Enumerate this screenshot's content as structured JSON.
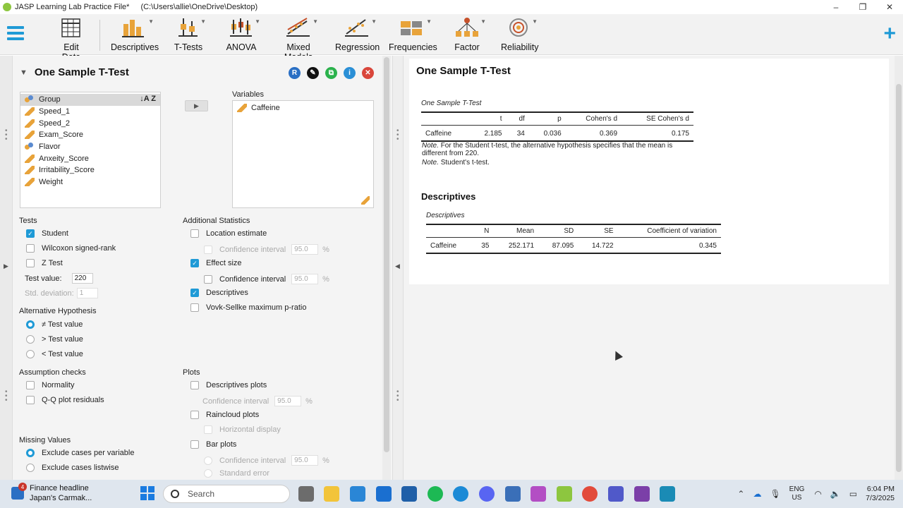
{
  "window": {
    "title": "JASP Learning Lab Practice File*",
    "path": "(C:\\Users\\allie\\OneDrive\\Desktop)",
    "minimize": "–",
    "maximize": "❐",
    "close": "✕"
  },
  "ribbon": {
    "edit_data": "Edit Data",
    "modules": [
      "Descriptives",
      "T-Tests",
      "ANOVA",
      "Mixed Models",
      "Regression",
      "Frequencies",
      "Factor",
      "Reliability"
    ],
    "plus": "+"
  },
  "analysis": {
    "title": "One Sample T-Test",
    "btn_r": "R",
    "btn_edit": "✎",
    "btn_copy": "⧉",
    "btn_info": "i",
    "btn_close": "✕",
    "available_vars": [
      {
        "name": "Group",
        "type": "nominal"
      },
      {
        "name": "Speed_1",
        "type": "scale"
      },
      {
        "name": "Speed_2",
        "type": "scale"
      },
      {
        "name": "Exam_Score",
        "type": "scale"
      },
      {
        "name": "Flavor",
        "type": "nominal"
      },
      {
        "name": "Anxeity_Score",
        "type": "scale"
      },
      {
        "name": "Irritability_Score",
        "type": "scale"
      },
      {
        "name": "Weight",
        "type": "scale"
      }
    ],
    "sort_icon": "↓A Z",
    "variables_label": "Variables",
    "selected_vars": [
      "Caffeine"
    ],
    "tests": {
      "label": "Tests",
      "student": "Student",
      "wilcoxon": "Wilcoxon signed-rank",
      "z_test": "Z Test",
      "test_value_label": "Test value:",
      "test_value": "220",
      "std_dev_label": "Std. deviation:",
      "std_dev": "1"
    },
    "alt_hypothesis": {
      "label": "Alternative Hypothesis",
      "neq": "≠ Test value",
      "gt": "> Test value",
      "lt": "< Test value"
    },
    "assumption": {
      "label": "Assumption checks",
      "normality": "Normality",
      "qq": "Q-Q plot residuals"
    },
    "missing": {
      "label": "Missing Values",
      "per_variable": "Exclude cases per variable",
      "listwise": "Exclude cases listwise"
    },
    "additional": {
      "label": "Additional Statistics",
      "location": "Location estimate",
      "ci": "Confidence interval",
      "ci_value": "95.0",
      "pct": "%",
      "effect_size": "Effect size",
      "ci2": "Confidence interval",
      "ci2_value": "95.0",
      "descriptives": "Descriptives",
      "vovk": "Vovk-Sellke maximum p-ratio"
    },
    "plots": {
      "label": "Plots",
      "desc_plots": "Descriptives plots",
      "ci": "Confidence interval",
      "ci_value": "95.0",
      "raincloud": "Raincloud plots",
      "horizontal": "Horizontal display",
      "bar": "Bar plots",
      "bar_ci": "Confidence interval",
      "bar_ci_value": "95.0",
      "std_error": "Standard error"
    }
  },
  "results": {
    "title": "One Sample T-Test",
    "table1": {
      "caption": "One Sample T-Test",
      "headers": [
        "",
        "t",
        "df",
        "p",
        "Cohen's d",
        "SE Cohen's d"
      ],
      "row": [
        "Caffeine",
        "2.185",
        "34",
        "0.036",
        "0.369",
        "0.175"
      ],
      "note1_label": "Note.",
      "note1": "For the Student t-test, the alternative hypothesis specifies that the mean is different from 220.",
      "note2_label": "Note.",
      "note2": "Student's t-test."
    },
    "desc_title": "Descriptives",
    "table2": {
      "caption": "Descriptives",
      "headers": [
        "",
        "N",
        "Mean",
        "SD",
        "SE",
        "Coefficient of variation"
      ],
      "row": [
        "Caffeine",
        "35",
        "252.171",
        "87.095",
        "14.722",
        "0.345"
      ]
    }
  },
  "taskbar": {
    "news_badge": "4",
    "news_line1": "Finance headline",
    "news_line2": "Japan's Carmak...",
    "search_placeholder": "Search",
    "lang1": "ENG",
    "lang2": "US",
    "time": "6:04 PM",
    "date": "7/3/2025"
  }
}
